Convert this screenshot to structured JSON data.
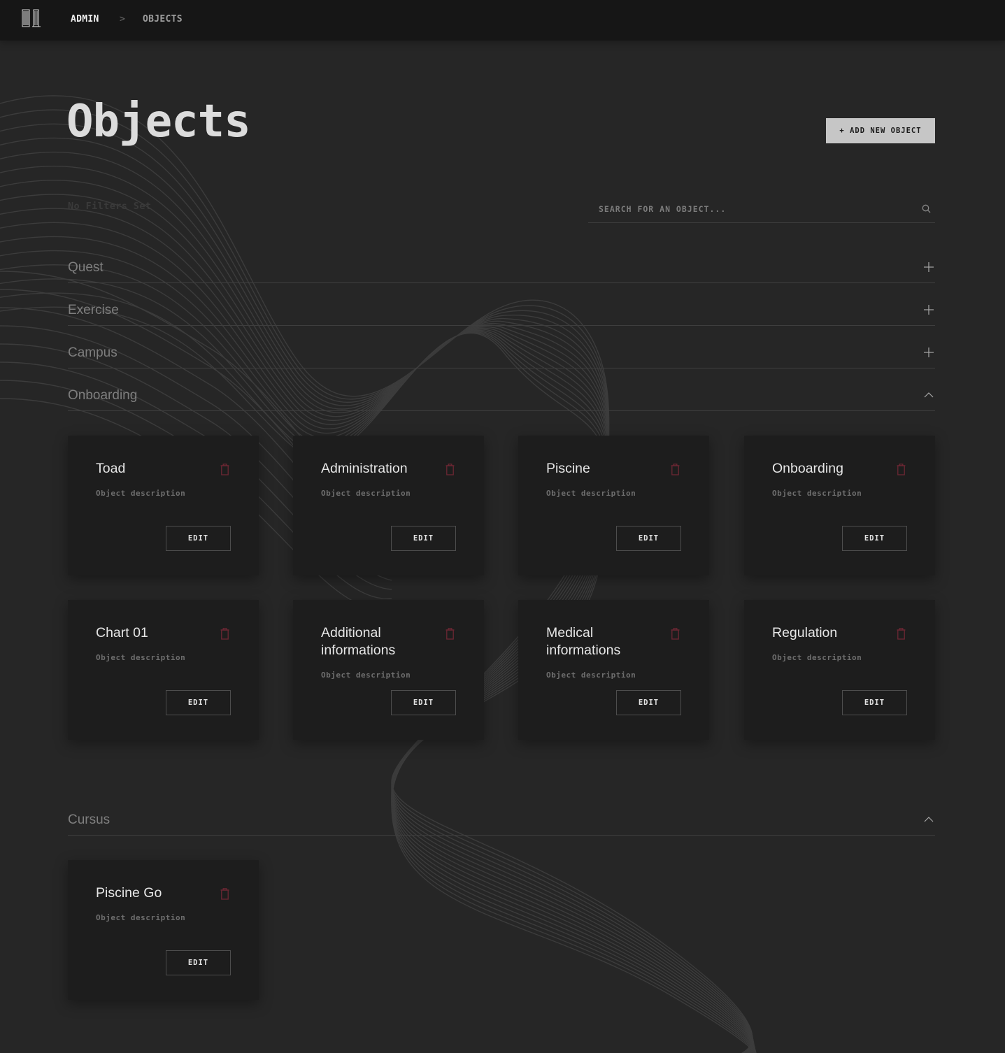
{
  "header": {
    "logo_label": "01",
    "breadcrumb": {
      "root": "ADMIN",
      "separator": ">",
      "current": "OBJECTS"
    }
  },
  "page": {
    "title": "Objects",
    "add_button": "+ ADD NEW OBJECT",
    "filters_text": "No Filters Set",
    "search_placeholder": "SEARCH FOR AN OBJECT..."
  },
  "sections": [
    {
      "label": "Quest",
      "state": "collapsed",
      "icon": "plus-icon"
    },
    {
      "label": "Exercise",
      "state": "collapsed",
      "icon": "plus-icon"
    },
    {
      "label": "Campus",
      "state": "collapsed",
      "icon": "plus-icon"
    },
    {
      "label": "Onboarding",
      "state": "expanded",
      "icon": "chevron-up-icon",
      "cards": [
        {
          "title": "Toad",
          "description": "Object description",
          "edit": "EDIT"
        },
        {
          "title": "Administration",
          "description": "Object description",
          "edit": "EDIT"
        },
        {
          "title": "Piscine",
          "description": "Object description",
          "edit": "EDIT"
        },
        {
          "title": "Onboarding",
          "description": "Object description",
          "edit": "EDIT"
        },
        {
          "title": "Chart 01",
          "description": "Object description",
          "edit": "EDIT"
        },
        {
          "title": "Additional informations",
          "description": "Object description",
          "edit": "EDIT"
        },
        {
          "title": "Medical informations",
          "description": "Object description",
          "edit": "EDIT"
        },
        {
          "title": "Regulation",
          "description": "Object description",
          "edit": "EDIT"
        }
      ]
    },
    {
      "label": "Cursus",
      "state": "expanded",
      "icon": "chevron-up-icon",
      "cards": [
        {
          "title": "Piscine Go",
          "description": "Object description",
          "edit": "EDIT"
        }
      ]
    }
  ],
  "colors": {
    "background": "#262626",
    "topbar": "#161616",
    "card": "#1d1d1d",
    "delete_icon": "#6b2733",
    "add_button_bg": "#c6c6c6"
  }
}
